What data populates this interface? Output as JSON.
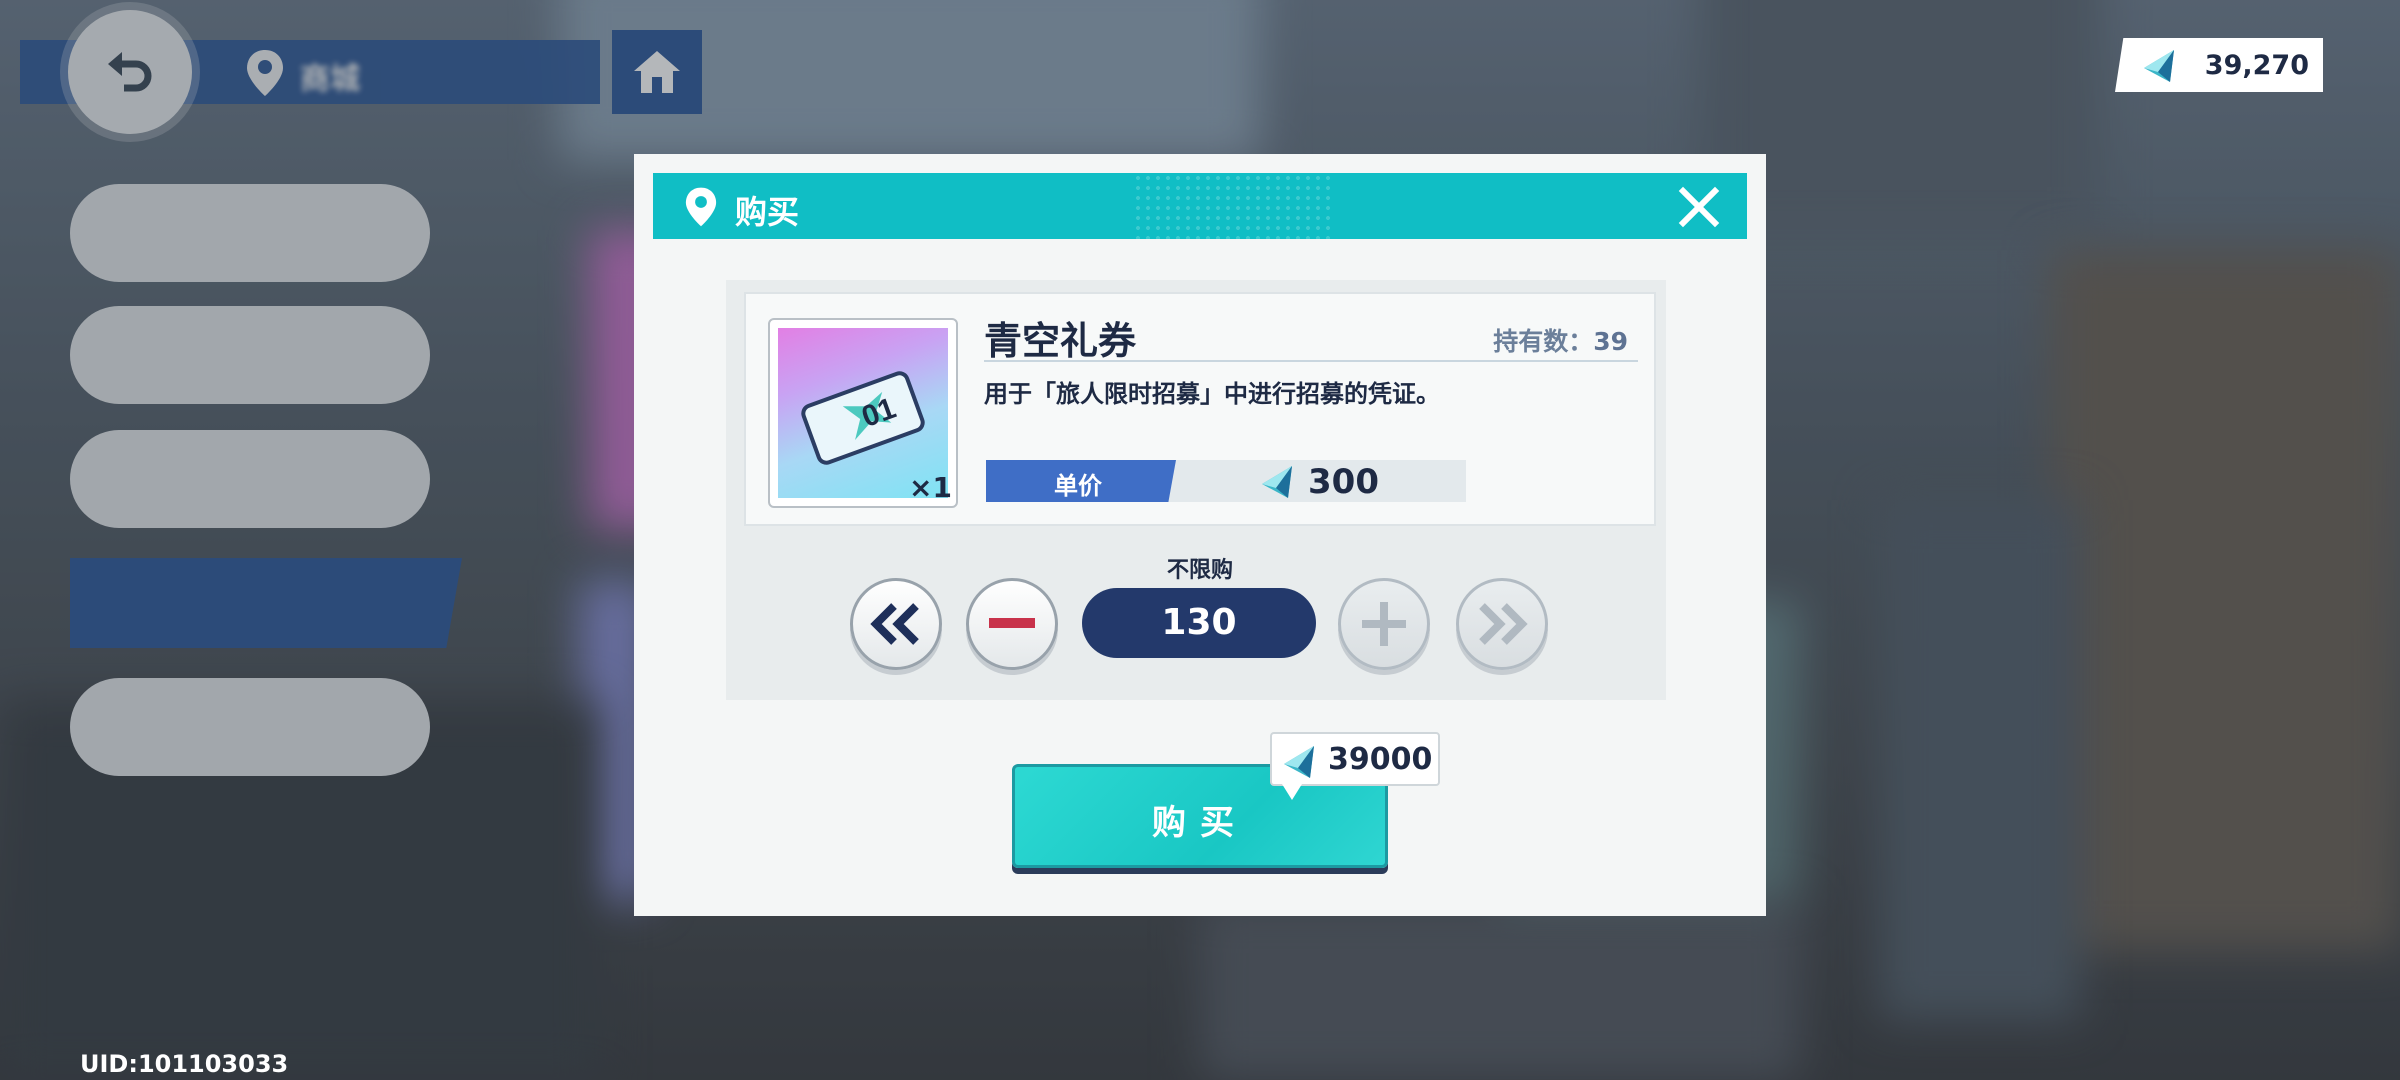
{
  "header": {
    "location_label": "商城"
  },
  "sidebar": {
    "items": [
      {
        "label": ""
      },
      {
        "label": ""
      },
      {
        "label": ""
      },
      {
        "label": ""
      },
      {
        "label": ""
      }
    ]
  },
  "currency": {
    "amount": "39,270",
    "icon": "gem-icon"
  },
  "user": {
    "uid": "UID:101103033"
  },
  "dialog": {
    "title": "购买",
    "item": {
      "name": "青空礼券",
      "quantity_label": "×1",
      "owned_label": "持有数：",
      "owned_count": "39",
      "description": "用于「旅人限时招募」中进行招募的凭证。",
      "unit_price_label": "单价",
      "unit_price": "300"
    },
    "purchase_limit": "不限购",
    "quantity": "130",
    "total_cost": "39000",
    "buy_label": "购买"
  },
  "colors": {
    "accent": "#10bec5",
    "navy": "#23396b",
    "price_label": "#3f6ec6",
    "minus": "#c8324b"
  }
}
